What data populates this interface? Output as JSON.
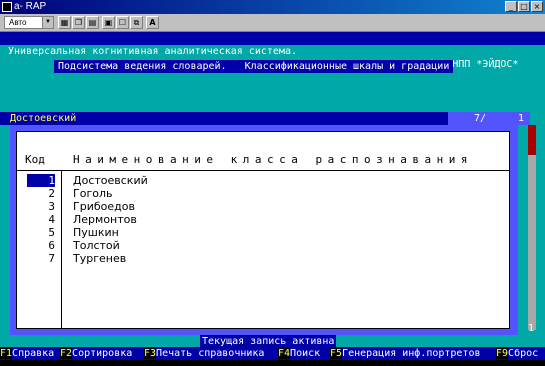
{
  "window": {
    "title": "a- RAP"
  },
  "toolbar": {
    "font_select": "Авто"
  },
  "app": {
    "header_left": "Универсальная когнитивная аналитическая система.",
    "header_right": "12:41  (c) НПП *ЭЙДОС*",
    "subtitle": "Подсистема ведения словарей.   Классификационные шкалы и градации"
  },
  "panel": {
    "title": "Достоевский",
    "page": "7/",
    "page_num": "1",
    "columns": {
      "code": "Код",
      "name": "Наименование класса распознавания"
    },
    "rows": [
      {
        "code": "1",
        "name": "Достоевский"
      },
      {
        "code": "2",
        "name": "Гоголь"
      },
      {
        "code": "3",
        "name": "Грибоедов"
      },
      {
        "code": "4",
        "name": "Лермонтов"
      },
      {
        "code": "5",
        "name": "Пушкин"
      },
      {
        "code": "6",
        "name": "Толстой"
      },
      {
        "code": "7",
        "name": "Тургенев"
      }
    ],
    "scroll_label": "1"
  },
  "status": "Текущая запись активна",
  "fkeys": [
    {
      "key": "F1",
      "label": "Справка"
    },
    {
      "key": "F2",
      "label": "Сортировка"
    },
    {
      "key": "F3",
      "label": "Печать справочника"
    },
    {
      "key": "F4",
      "label": "Поиск"
    },
    {
      "key": "F5",
      "label": "Генерация инф.портретов"
    },
    {
      "key": "F9",
      "label": "Сброс"
    }
  ]
}
